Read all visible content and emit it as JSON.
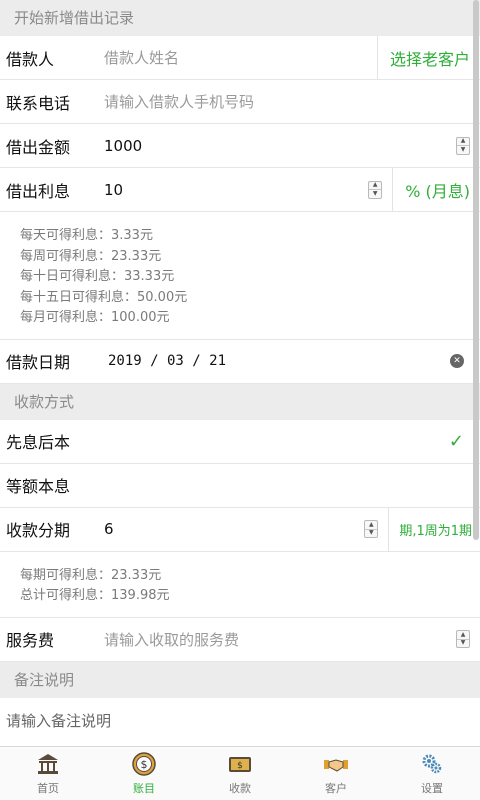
{
  "header": {
    "title": "开始新增借出记录"
  },
  "borrower": {
    "label": "借款人",
    "placeholder": "借款人姓名",
    "select_label": "选择老客户"
  },
  "phone": {
    "label": "联系电话",
    "placeholder": "请输入借款人手机号码"
  },
  "amount": {
    "label": "借出金额",
    "value": "1000"
  },
  "interest": {
    "label": "借出利息",
    "value": "10",
    "unit": "% (月息)"
  },
  "interest_info": [
    "每天可得利息：3.33元",
    "每周可得利息：23.33元",
    "每十日可得利息：33.33元",
    "每十五日可得利息：50.00元",
    "每月可得利息：100.00元"
  ],
  "date": {
    "label": "借款日期",
    "value": "2019 / 03 / 21"
  },
  "repay_section": {
    "title": "收款方式"
  },
  "repay_options": [
    {
      "label": "先息后本",
      "selected": true
    },
    {
      "label": "等额本息",
      "selected": false
    }
  ],
  "periods": {
    "label": "收款分期",
    "value": "6",
    "unit": "期,1周为1期"
  },
  "period_info": [
    "每期可得利息：23.33元",
    "总计可得利息：139.98元"
  ],
  "fee": {
    "label": "服务费",
    "placeholder": "请输入收取的服务费"
  },
  "notes_section": {
    "title": "备注说明"
  },
  "notes": {
    "placeholder": "请输入备注说明"
  },
  "tabs": [
    {
      "label": "首页",
      "icon": "bank-icon",
      "active": false
    },
    {
      "label": "账目",
      "icon": "dollar-coin-icon",
      "active": true
    },
    {
      "label": "收款",
      "icon": "cash-icon",
      "active": false
    },
    {
      "label": "客户",
      "icon": "handshake-icon",
      "active": false
    },
    {
      "label": "设置",
      "icon": "gears-icon",
      "active": false
    }
  ],
  "colors": {
    "accent": "#2fae3a",
    "section_bg": "#ececec"
  }
}
